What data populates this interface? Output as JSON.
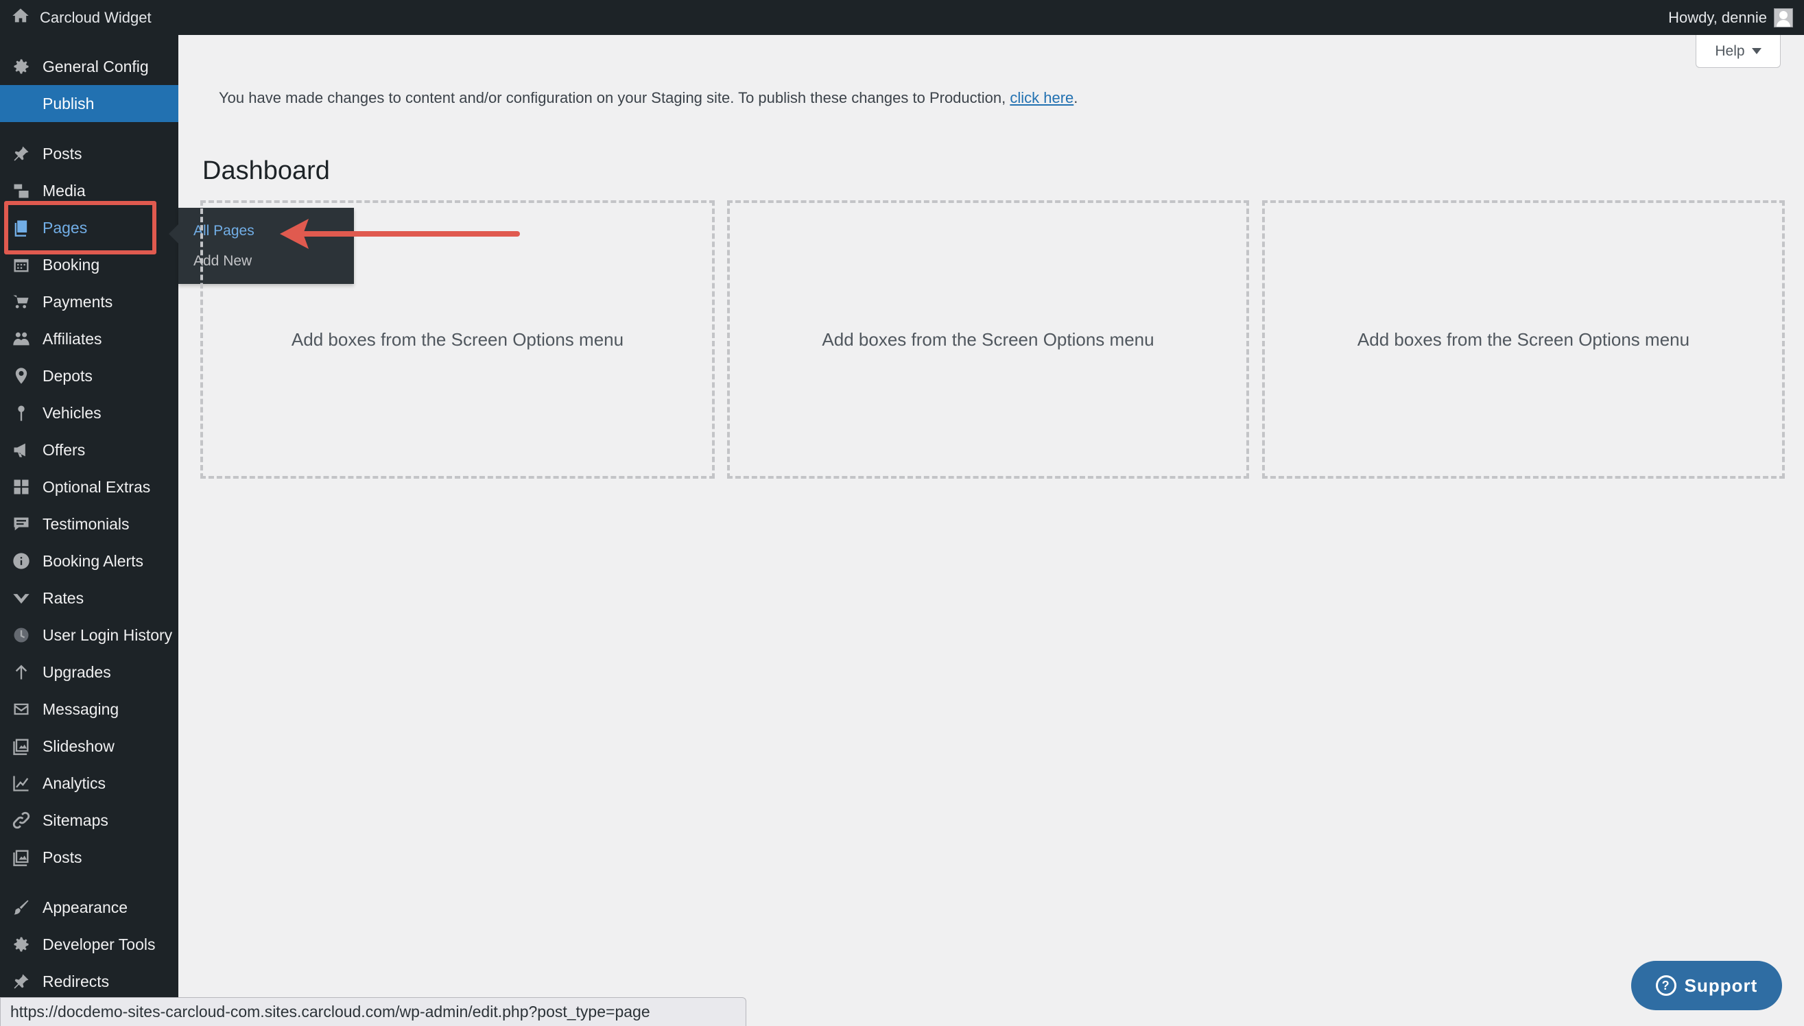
{
  "adminbar": {
    "site_name": "Carcloud Widget",
    "greeting": "Howdy, dennie"
  },
  "sidebar": {
    "items": [
      {
        "label": "General Config",
        "icon": "gear-icon"
      },
      {
        "label": "Publish",
        "icon": "",
        "state": "active"
      },
      {
        "label": "Posts",
        "icon": "pin-icon"
      },
      {
        "label": "Media",
        "icon": "media-icon"
      },
      {
        "label": "Pages",
        "icon": "pages-icon",
        "state": "highlighted"
      },
      {
        "label": "Booking",
        "icon": "calendar-icon"
      },
      {
        "label": "Payments",
        "icon": "cart-icon"
      },
      {
        "label": "Affiliates",
        "icon": "groups-icon"
      },
      {
        "label": "Depots",
        "icon": "location-icon"
      },
      {
        "label": "Vehicles",
        "icon": "pin-marker-icon"
      },
      {
        "label": "Offers",
        "icon": "megaphone-icon"
      },
      {
        "label": "Optional Extras",
        "icon": "grid-icon"
      },
      {
        "label": "Testimonials",
        "icon": "comment-icon"
      },
      {
        "label": "Booking Alerts",
        "icon": "info-icon"
      },
      {
        "label": "Rates",
        "icon": "chart-icon"
      },
      {
        "label": "User Login History",
        "icon": "clock-icon"
      },
      {
        "label": "Upgrades",
        "icon": "arrow-up-icon"
      },
      {
        "label": "Messaging",
        "icon": "email-icon"
      },
      {
        "label": "Slideshow",
        "icon": "gallery-icon"
      },
      {
        "label": "Analytics",
        "icon": "line-chart-icon"
      },
      {
        "label": "Sitemaps",
        "icon": "link-icon"
      },
      {
        "label": "Posts",
        "icon": "gallery-icon"
      },
      {
        "label": "Appearance",
        "icon": "brush-icon"
      },
      {
        "label": "Developer Tools",
        "icon": "gear-icon"
      },
      {
        "label": "Redirects",
        "icon": "pin-icon"
      }
    ]
  },
  "flyout": {
    "items": [
      "All Pages",
      "Add New"
    ]
  },
  "main": {
    "help_label": "Help",
    "notice_text": "You have made changes to content and/or configuration on your Staging site. To publish these changes to Production, ",
    "notice_link": "click here",
    "notice_end": ".",
    "title": "Dashboard",
    "boxes": [
      "Add boxes from the Screen Options menu",
      "Add boxes from the Screen Options menu",
      "Add boxes from the Screen Options menu"
    ]
  },
  "status_url": "https://docdemo-sites-carcloud-com.sites.carcloud.com/wp-admin/edit.php?post_type=page",
  "support_label": "Support",
  "colors": {
    "sidebar_bg": "#1d2327",
    "active_bg": "#2271b1",
    "highlight": "#e05a4f",
    "support_bg": "#2f6da3"
  }
}
